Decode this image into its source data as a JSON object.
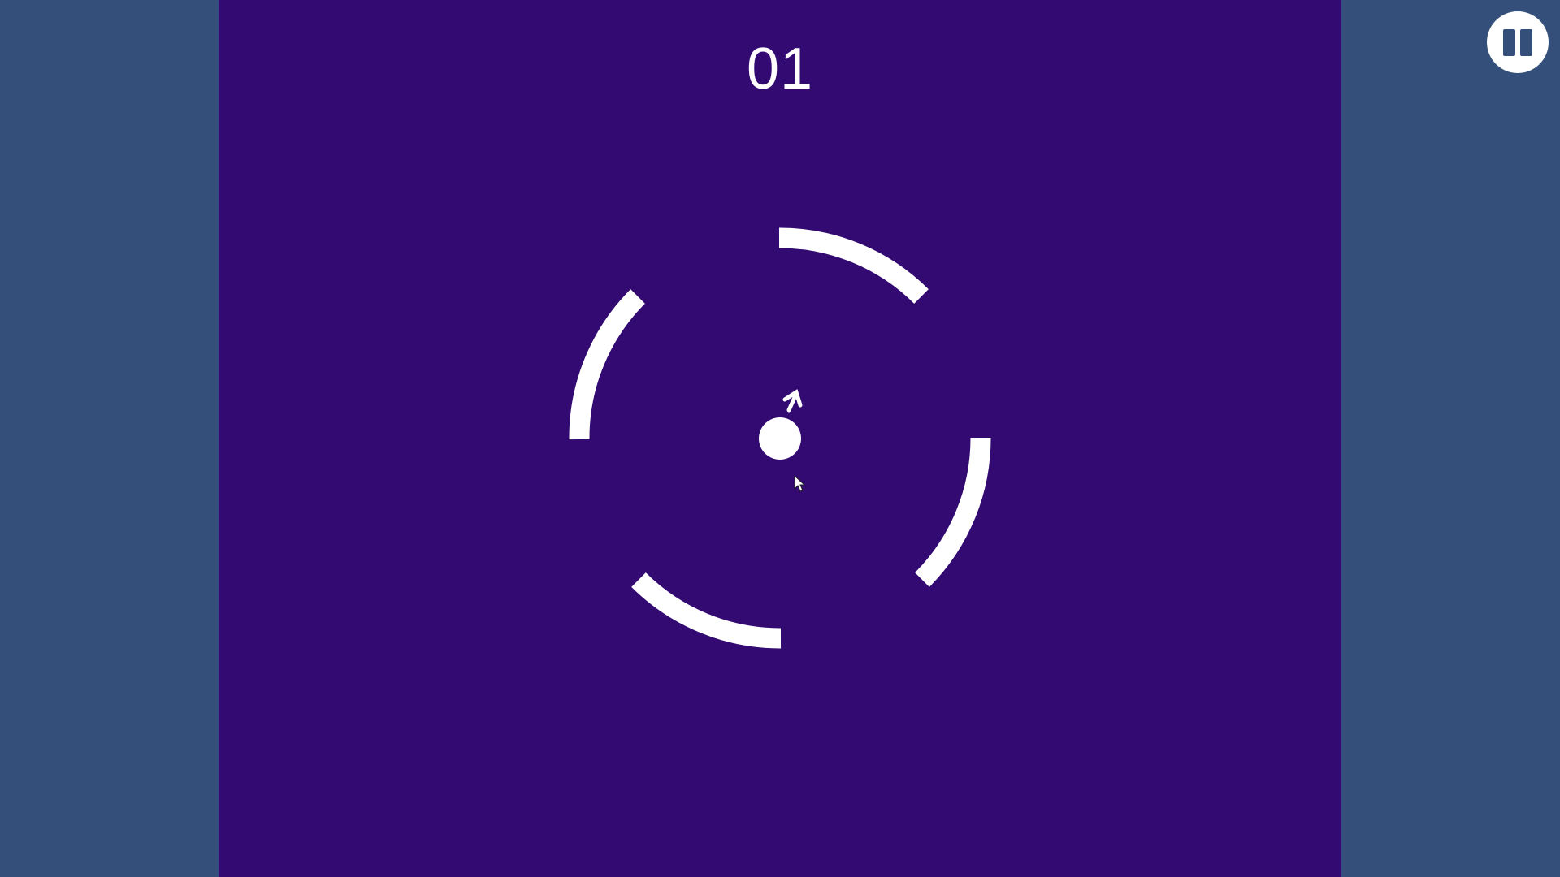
{
  "game": {
    "score": "01",
    "pause_icon": "pause-icon"
  },
  "colors": {
    "outer_background": "#34507a",
    "play_area": "#320a72",
    "foreground": "#ffffff"
  },
  "ring": {
    "segment_count": 4,
    "gap_count": 4
  }
}
